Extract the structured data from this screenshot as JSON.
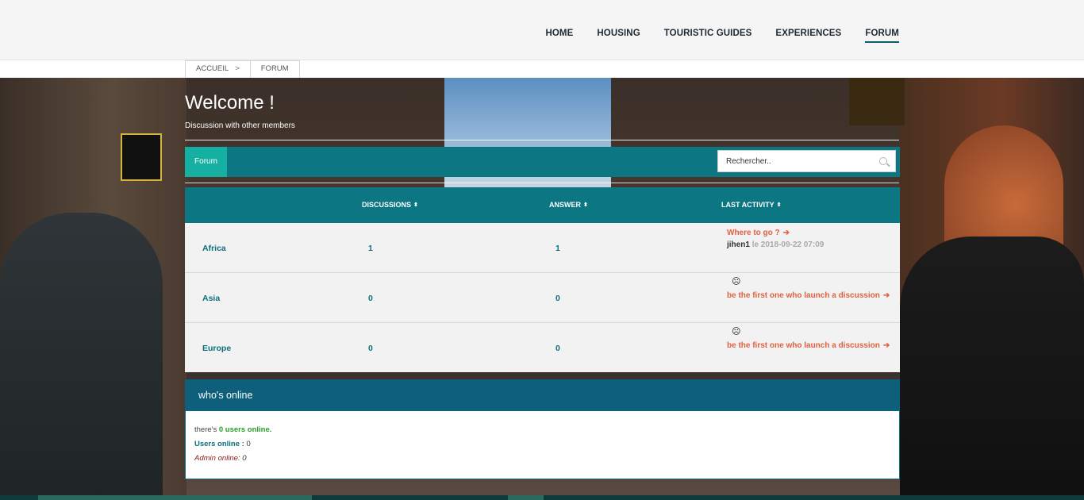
{
  "nav": {
    "items": [
      {
        "label": "HOME"
      },
      {
        "label": "HOUSING"
      },
      {
        "label": "TOURISTIC GUIDES"
      },
      {
        "label": "EXPERIENCES"
      },
      {
        "label": "FORUM",
        "active": true
      }
    ]
  },
  "breadcrumb": {
    "home": "ACCUEIL",
    "separator": ">",
    "current": "FORUM"
  },
  "hero": {
    "title": "Welcome !",
    "subtitle": "Discussion with other members"
  },
  "forumbar": {
    "tab_label": "Forum",
    "search_placeholder": "Rechercher.."
  },
  "table": {
    "headers": {
      "discussions": "DISCUSSIONS",
      "answer": "ANSWER",
      "last_activity": "LAST ACTIVITY",
      "sort_symbol": "⬍"
    },
    "rows": [
      {
        "category": "Africa",
        "discussions": "1",
        "answers": "1",
        "last_topic": "Where to go ?",
        "last_user": "jihen1",
        "last_date": "le 2018-09-22 07:09"
      },
      {
        "category": "Asia",
        "discussions": "0",
        "answers": "0",
        "empty_icon": "sad-face-icon",
        "empty_text": "be the first one who launch a discussion"
      },
      {
        "category": "Europe",
        "discussions": "0",
        "answers": "0",
        "empty_icon": "sad-face-icon",
        "empty_text": "be the first one who launch a discussion"
      }
    ]
  },
  "online": {
    "title": "who's online",
    "line1_prefix": "there's",
    "line1_count": "0",
    "line1_suffix": "users online.",
    "users_label": "Users online :",
    "users_value": "0",
    "admin_label": "Admin online:",
    "admin_value": "0"
  },
  "colors": {
    "accent_teal": "#0c7683",
    "tab_active": "#16b0a2",
    "link_orange": "#e0613f",
    "online_header": "#0d5f7b"
  }
}
